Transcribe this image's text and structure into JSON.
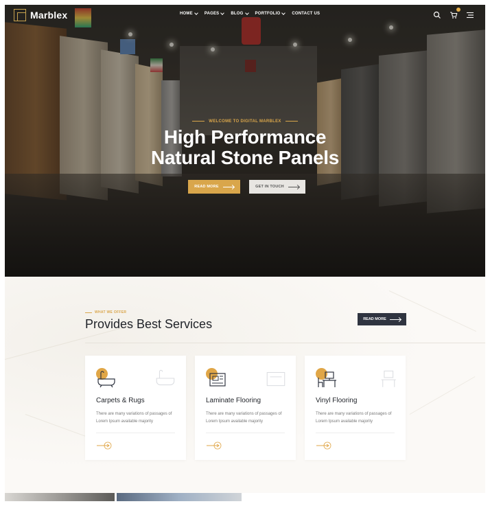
{
  "nav": {
    "logo": "Marblex",
    "menu": [
      {
        "label": "HOME",
        "has_dropdown": true
      },
      {
        "label": "PAGES",
        "has_dropdown": true
      },
      {
        "label": "BLOG",
        "has_dropdown": true
      },
      {
        "label": "PORTFOLIO",
        "has_dropdown": true
      },
      {
        "label": "CONTACT US",
        "has_dropdown": false
      }
    ],
    "icons": [
      "search-icon",
      "cart-icon",
      "hamburger-menu-icon"
    ]
  },
  "hero": {
    "subtitle": "WELCOME TO DIGITAL MARBLEX",
    "title_line1": "High Performance",
    "title_line2": "Natural Stone Panels",
    "primary_button": "READ MORE",
    "secondary_button": "GET IN TOUCH"
  },
  "services": {
    "tag": "WHAT WE OFFER",
    "title": "Provides Best Services",
    "button": "READ MORE",
    "cards": [
      {
        "title": "Carpets & Rugs",
        "text": "There are many variations of passages of Lorem Ipsum available majority",
        "icon": "bathtub-icon"
      },
      {
        "title": "Laminate Flooring",
        "text": "There are many variations of passages of Lorem Ipsum available majority",
        "icon": "laminate-icon"
      },
      {
        "title": "Vinyl Flooring",
        "text": "There are many variations of passages of Lorem Ipsum available majority",
        "icon": "workspace-icon"
      }
    ]
  },
  "colors": {
    "accent": "#d9a64b",
    "dark": "#2f3440",
    "text": "#1f2228"
  }
}
